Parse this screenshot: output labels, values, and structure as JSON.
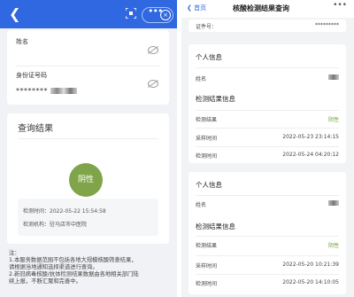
{
  "left": {
    "name_label": "姓名",
    "id_label": "身份证号码",
    "id_value": "********",
    "result_title": "查询结果",
    "status": "阴性",
    "time_label": "检测时间：",
    "time_value": "2022-05-22 15:54:58",
    "org_label": "检测机构：",
    "org_value": "驻马店市中医院",
    "note_title": "注：",
    "note_lines": [
      "1.本服务数据范围不包括各地大规模核酸筛查结果，",
      "请根据当地通知选择渠道进行查询。",
      "2.新冠病毒核酸/抗体检测结果数据由各地相关部门陆",
      "续上报，不断汇聚和完善中。"
    ]
  },
  "right": {
    "back_label": "首页",
    "title": "核酸检测结果查询",
    "cert_label": "证件号：",
    "cert_value": "*********",
    "sections": [
      {
        "personal_title": "个人信息",
        "name_label": "姓名",
        "detect_title": "检测结果信息",
        "result_label": "检测结果",
        "result_value": "阴性",
        "sample_label": "采样时间",
        "sample_value": "2022-05-23 23:14:15",
        "test_label": "检测时间",
        "test_value": "2022-05-24 04:20:12"
      },
      {
        "personal_title": "个人信息",
        "name_label": "姓名",
        "detect_title": "检测结果信息",
        "result_label": "检测结果",
        "result_value": "阴性",
        "sample_label": "采样时间",
        "sample_value": "2022-05-20 10:21:39",
        "test_label": "检测时间",
        "test_value": "2022-05-20 14:10:05"
      }
    ]
  },
  "colors": {
    "brand": "#2f68e0",
    "negative": "#7fa44a",
    "green_text": "#6aa23c"
  }
}
